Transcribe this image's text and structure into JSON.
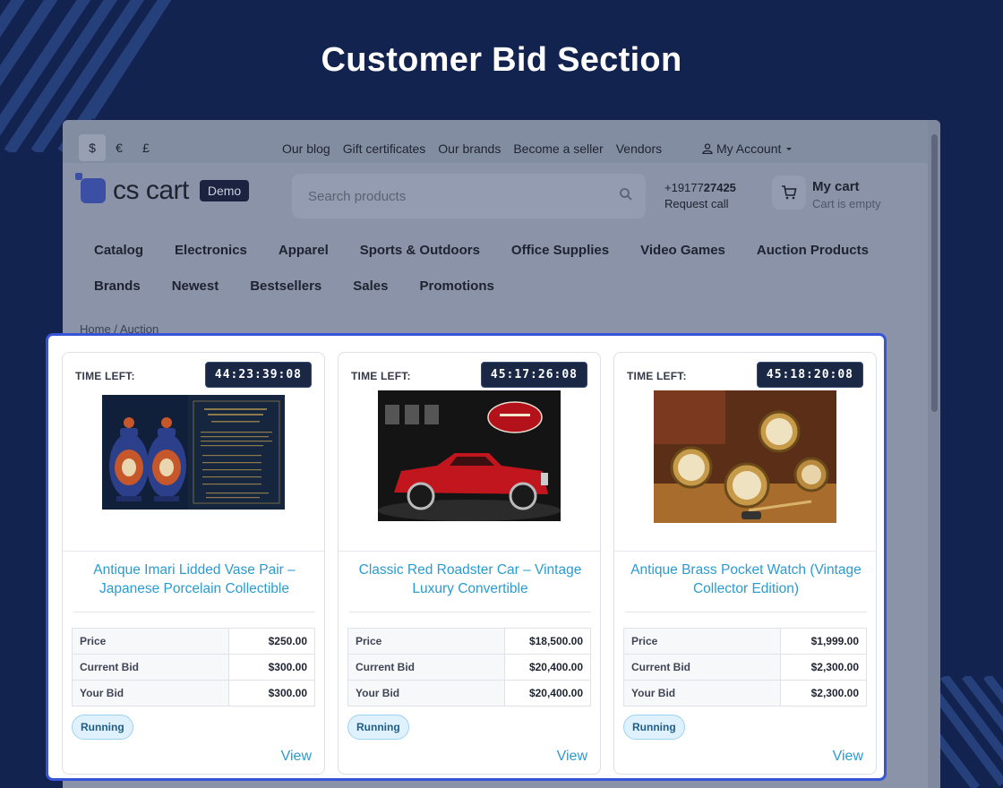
{
  "page_title": "Customer Bid Section",
  "store": {
    "currencies": [
      "$",
      "€",
      "£"
    ],
    "active_currency": "$",
    "top_links": [
      "Our blog",
      "Gift certificates",
      "Our brands",
      "Become a seller",
      "Vendors"
    ],
    "account_label": "My Account",
    "logo_text": "cs cart",
    "logo_badge": "Demo",
    "search_placeholder": "Search products",
    "phone_prefix": "+19177",
    "phone_bold": "27425",
    "request_call": "Request call",
    "cart_title": "My cart",
    "cart_status": "Cart is empty",
    "nav_row1": [
      "Catalog",
      "Electronics",
      "Apparel",
      "Sports & Outdoors",
      "Office Supplies",
      "Video Games",
      "Auction Products"
    ],
    "nav_row2": [
      "Brands",
      "Newest",
      "Bestsellers",
      "Sales",
      "Promotions"
    ],
    "breadcrumb_home": "Home",
    "breadcrumb_sep": "/",
    "breadcrumb_current": "Auction"
  },
  "labels": {
    "time_left": "TIME LEFT:",
    "price": "Price",
    "current_bid": "Current Bid",
    "your_bid": "Your Bid",
    "view": "View"
  },
  "auctions": [
    {
      "timer": "44:23:39:08",
      "title": "Antique Imari Lidded Vase Pair – Japanese Porcelain Collectible",
      "price": "$250.00",
      "current_bid": "$300.00",
      "your_bid": "$300.00",
      "status": "Running"
    },
    {
      "timer": "45:17:26:08",
      "title": "Classic Red Roadster Car – Vintage Luxury Convertible",
      "price": "$18,500.00",
      "current_bid": "$20,400.00",
      "your_bid": "$20,400.00",
      "status": "Running"
    },
    {
      "timer": "45:18:20:08",
      "title": "Antique Brass Pocket Watch (Vintage Collector Edition)",
      "price": "$1,999.00",
      "current_bid": "$2,300.00",
      "your_bid": "$2,300.00",
      "status": "Running"
    }
  ],
  "colors": {
    "background": "#13234f",
    "panel_border": "#3654d8",
    "link": "#2a9bd0",
    "timer_bg": "#1a2845"
  }
}
